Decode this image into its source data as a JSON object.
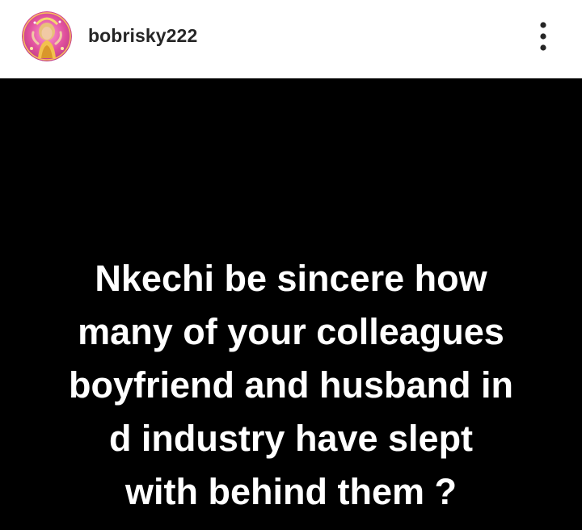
{
  "post": {
    "username": "bobrisky222",
    "avatar_icon": "profile-avatar",
    "more_icon": "more-options-vertical-icon",
    "caption": "Nkechi be sincere how\nmany of your colleagues\nboyfriend and husband in\nd industry have slept\nwith behind them ?",
    "colors": {
      "header_bg": "#ffffff",
      "username": "#262626",
      "post_bg": "#000000",
      "post_text": "#ffffff"
    }
  }
}
